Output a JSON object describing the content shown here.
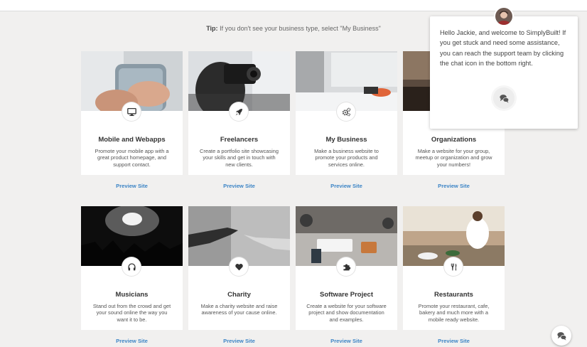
{
  "tip": {
    "label": "Tip:",
    "text": " If you don't see your business type, select \"My Business\""
  },
  "cards": [
    {
      "title": "Mobile and Webapps",
      "desc": "Promote your mobile app with a great product homepage, and support contact.",
      "preview": "Preview Site",
      "icon": "monitor-icon"
    },
    {
      "title": "Freelancers",
      "desc": "Create a portfolio site showcasing your skills and get in touch with new clients.",
      "preview": "Preview Site",
      "icon": "rocket-icon"
    },
    {
      "title": "My Business",
      "desc": "Make a business website to promote your products and services online.",
      "preview": "Preview Site",
      "icon": "gears-icon"
    },
    {
      "title": "Organizations",
      "desc": "Make a website for your group, meetup or organization and grow your numbers!",
      "preview": "Preview Site",
      "icon": "group-icon"
    },
    {
      "title": "Musicians",
      "desc": "Stand out from the crowd and get your sound online the way you want it to be.",
      "preview": "Preview Site",
      "icon": "headphones-icon"
    },
    {
      "title": "Charity",
      "desc": "Make a charity website and raise awareness of your cause online.",
      "preview": "Preview Site",
      "icon": "heart-icon"
    },
    {
      "title": "Software Project",
      "desc": "Create a website for your software project and show documentation and examples.",
      "preview": "Preview Site",
      "icon": "puzzle-icon"
    },
    {
      "title": "Restaurants",
      "desc": "Promote your restaurant, cafe, bakery and much more with a mobile ready website.",
      "preview": "Preview Site",
      "icon": "cutlery-icon"
    }
  ],
  "popup": {
    "message": "Hello Jackie, and welcome to SimplyBuilt! If you get stuck and need some assistance, you can reach the support team by clicking the chat icon in the bottom right.",
    "icon": "chat-bubbles-icon"
  },
  "avatar": {
    "icon": "avatar"
  },
  "chat_fab": {
    "icon": "chat-bubbles-icon"
  },
  "colors": {
    "link": "#3d85c6",
    "background": "#f1f0ef",
    "card": "#ffffff"
  }
}
